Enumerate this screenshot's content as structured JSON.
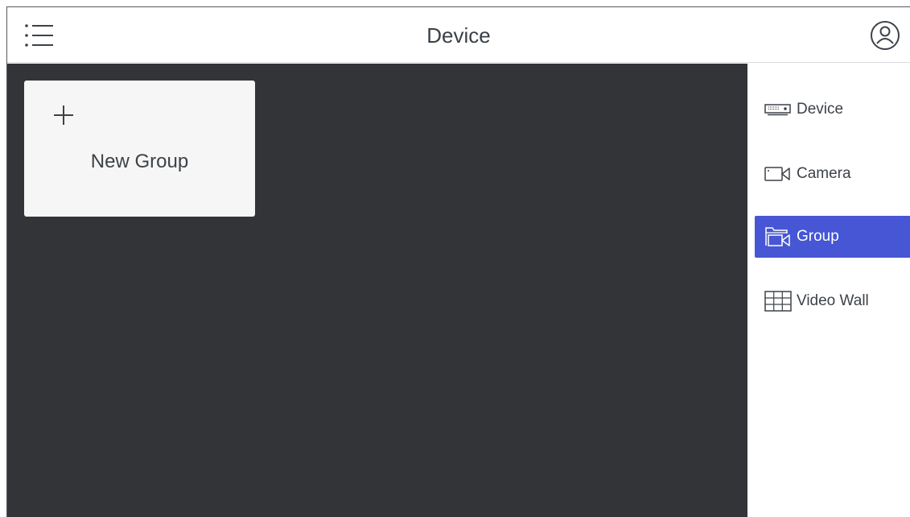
{
  "header": {
    "title": "Device",
    "menu_icon": "menu-list-icon",
    "user_icon": "user-circle-icon"
  },
  "main": {
    "new_group": {
      "icon": "plus-icon",
      "label": "New Group"
    }
  },
  "sidebar": {
    "items": [
      {
        "label": "Device",
        "icon": "device-recorder-icon",
        "active": false
      },
      {
        "label": "Camera",
        "icon": "camera-icon",
        "active": false
      },
      {
        "label": "Group",
        "icon": "group-folder-icon",
        "active": true
      },
      {
        "label": "Video Wall",
        "icon": "video-wall-icon",
        "active": false
      }
    ]
  },
  "colors": {
    "accent": "#4656d4",
    "content_background": "#323438",
    "card_background": "#f6f6f6",
    "text": "#3d4249"
  }
}
